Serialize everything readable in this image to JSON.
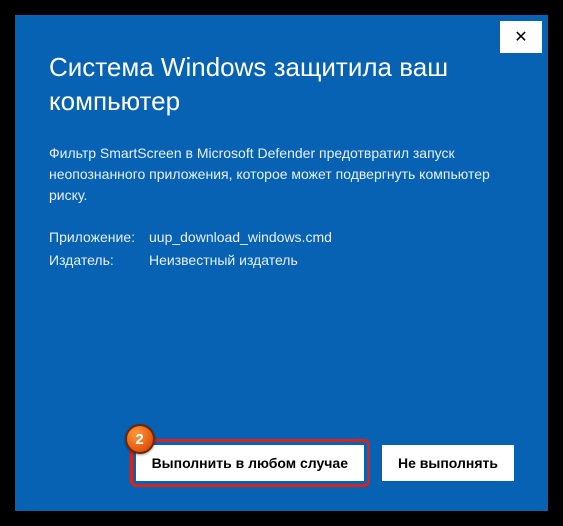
{
  "dialog": {
    "title": "Система Windows защитила ваш компьютер",
    "description": "Фильтр SmartScreen в Microsoft Defender предотвратил запуск неопознанного приложения, которое может подвергнуть компьютер риску.",
    "app_label": "Приложение:",
    "app_value": "uup_download_windows.cmd",
    "publisher_label": "Издатель:",
    "publisher_value": "Неизвестный издатель",
    "close_icon": "✕",
    "run_anyway": "Выполнить в любом случае",
    "dont_run": "Не выполнять"
  },
  "annotation": {
    "badge_number": "2"
  },
  "colors": {
    "dialog_bg": "#0762b3",
    "highlight": "#d6231b"
  }
}
